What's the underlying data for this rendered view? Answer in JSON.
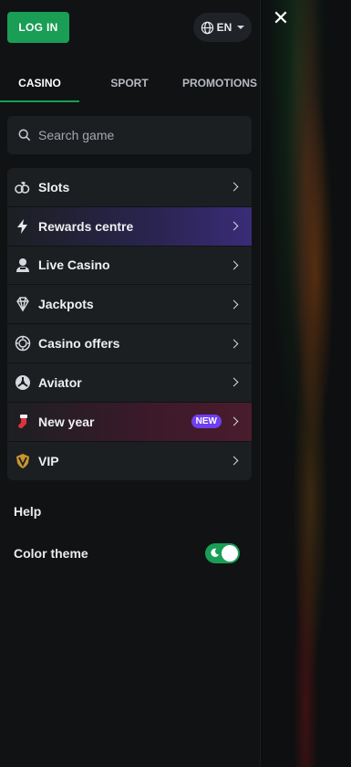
{
  "header": {
    "login_label": "LOG IN",
    "language": "EN",
    "close_symbol": "✕"
  },
  "tabs": [
    {
      "label": "CASINO",
      "active": true
    },
    {
      "label": "SPORT",
      "active": false
    },
    {
      "label": "PROMOTIONS",
      "active": false
    }
  ],
  "search": {
    "placeholder": "Search game",
    "value": ""
  },
  "menu": {
    "items": [
      {
        "label": "Slots",
        "icon": "slots-icon"
      },
      {
        "label": "Rewards centre",
        "icon": "lightning-icon"
      },
      {
        "label": "Live Casino",
        "icon": "dealer-icon"
      },
      {
        "label": "Jackpots",
        "icon": "diamond-icon"
      },
      {
        "label": "Casino offers",
        "icon": "chip-icon"
      },
      {
        "label": "Aviator",
        "icon": "aviator-icon"
      },
      {
        "label": "New year",
        "icon": "stocking-icon",
        "badge": "NEW"
      },
      {
        "label": "VIP",
        "icon": "vip-shield-icon"
      }
    ]
  },
  "footer": {
    "help_label": "Help",
    "theme_label": "Color theme",
    "theme_on": true
  },
  "colors": {
    "accent": "#1a9d55",
    "badge": "#6f3ff0",
    "panel": "#101214",
    "surface": "#1c1f22"
  }
}
